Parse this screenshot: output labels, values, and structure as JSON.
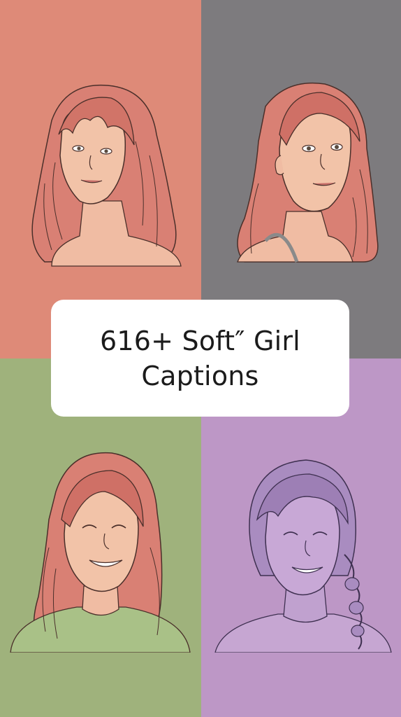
{
  "title": {
    "line1": "616+ Soft″ Girl",
    "line2": "Captions"
  },
  "colors": {
    "top_left_bg": "#de8a78",
    "top_right_bg": "#7d7b7e",
    "bottom_left_bg": "#9fb27c",
    "bottom_right_bg": "#bd97c6",
    "hair_pink": "#d98074",
    "hair_purple": "#a98cc0",
    "skin": "#f2c3a8",
    "line": "#4a2f2a"
  },
  "portraits": [
    {
      "quadrant": "top-left",
      "subject": "girl-with-bangs-illustration"
    },
    {
      "quadrant": "top-right",
      "subject": "girl-side-glance-illustration"
    },
    {
      "quadrant": "bottom-left",
      "subject": "smiling-girl-illustration"
    },
    {
      "quadrant": "bottom-right",
      "subject": "girl-with-braid-illustration"
    }
  ]
}
